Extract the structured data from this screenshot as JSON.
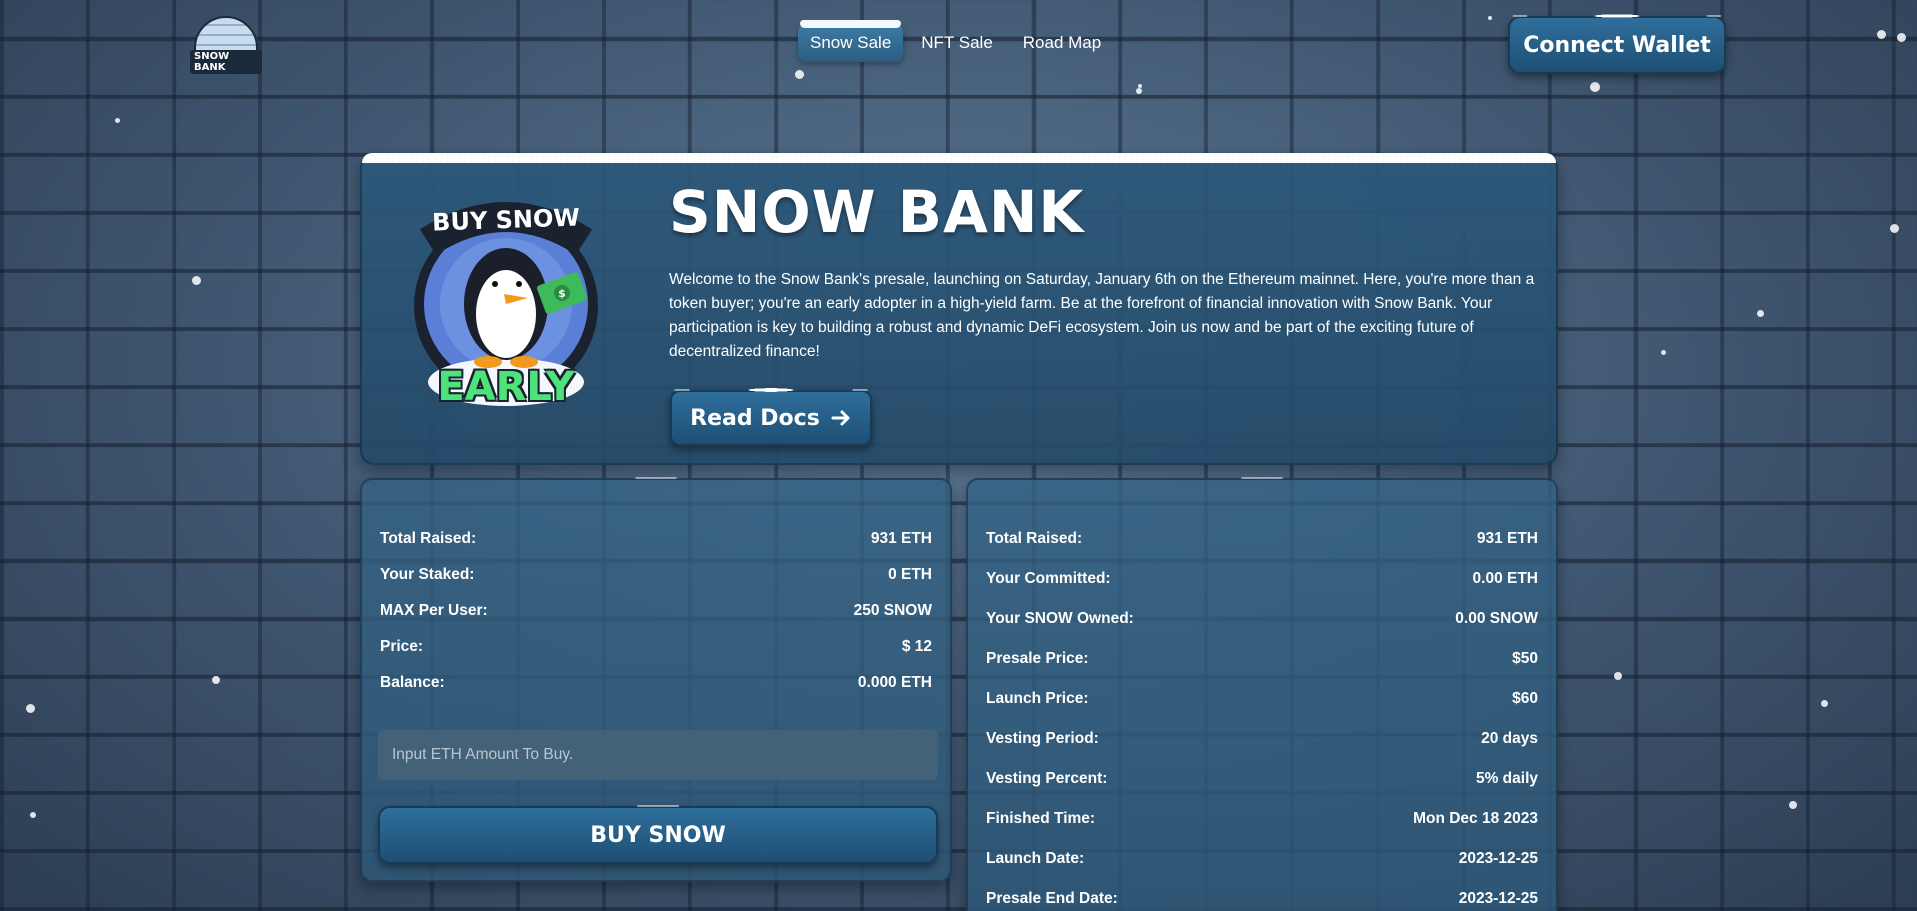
{
  "logo": {
    "text": "SNOW BANK"
  },
  "nav": {
    "items": [
      "Snow Sale",
      "NFT Sale",
      "Road Map"
    ],
    "active": "Snow Sale"
  },
  "header": {
    "connect_wallet": "Connect Wallet"
  },
  "hero": {
    "mascot_top": "BUY SNOW",
    "mascot_bottom": "EARLY",
    "title": "SNOW BANK",
    "description": "Welcome to the Snow Bank's presale, launching on Saturday, January 6th on the Ethereum mainnet. Here, you're more than a token buyer; you're an early adopter in a high-yield farm. Be at the forefront of financial innovation with Snow Bank. Your participation is key to building a robust and dynamic DeFi ecosystem. Join us now and be part of the exciting future of decentralized finance!",
    "read_docs": "Read Docs",
    "read_docs_icon": "arrow-right-icon"
  },
  "buy_panel": {
    "rows": [
      {
        "label": "Total Raised:",
        "value": "931 ETH"
      },
      {
        "label": "Your Staked:",
        "value": "0 ETH"
      },
      {
        "label": "MAX Per User:",
        "value": "250 SNOW"
      },
      {
        "label": "Price:",
        "value": "$ 12"
      },
      {
        "label": "Balance:",
        "value": "0.000 ETH"
      }
    ],
    "input_placeholder": "Input ETH Amount To Buy.",
    "buy_button": "BUY SNOW"
  },
  "info_panel": {
    "rows": [
      {
        "label": "Total Raised:",
        "value": "931 ETH"
      },
      {
        "label": "Your Committed:",
        "value": "0.00 ETH"
      },
      {
        "label": "Your SNOW Owned:",
        "value": "0.00 SNOW"
      },
      {
        "label": "Presale Price:",
        "value": "$50"
      },
      {
        "label": "Launch Price:",
        "value": "$60"
      },
      {
        "label": "Vesting Period:",
        "value": "20 days"
      },
      {
        "label": "Vesting Percent:",
        "value": "5% daily"
      },
      {
        "label": "Finished Time:",
        "value": "Mon Dec 18 2023"
      },
      {
        "label": "Launch Date:",
        "value": "2023-12-25"
      },
      {
        "label": "Presale End Date:",
        "value": "2023-12-25"
      }
    ]
  },
  "colors": {
    "button": "#2f6f9c",
    "card": "#2c587a",
    "background": "#3b4f66"
  }
}
